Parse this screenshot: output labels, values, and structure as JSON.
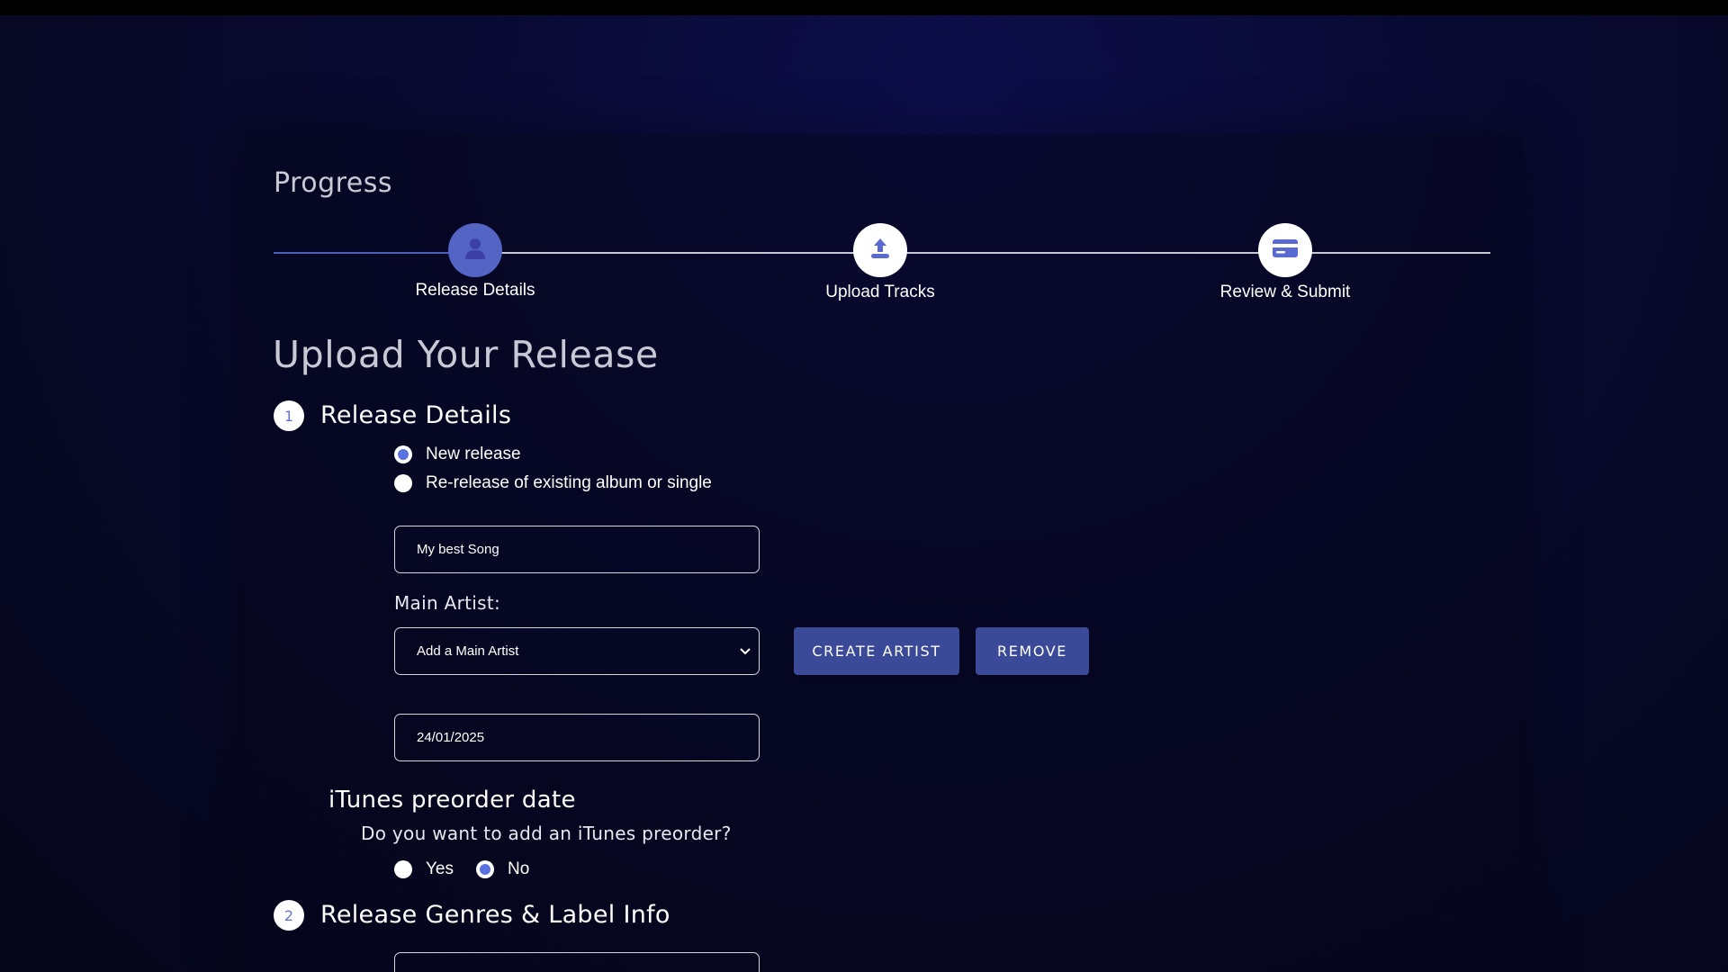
{
  "progress": {
    "title": "Progress",
    "steps": [
      {
        "label": "Release Details",
        "icon": "person-icon",
        "state": "active"
      },
      {
        "label": "Upload Tracks",
        "icon": "upload-icon",
        "state": "idle"
      },
      {
        "label": "Review & Submit",
        "icon": "credit-card-icon",
        "state": "idle"
      }
    ]
  },
  "main": {
    "title": "Upload Your Release",
    "section1": {
      "number": "1",
      "title": "Release Details",
      "release_type": {
        "options": [
          "New release",
          "Re-release of existing album or single"
        ],
        "selected": "New release"
      },
      "release_title_value": "My best Song",
      "main_artist_label": "Main Artist:",
      "main_artist_select_value": "Add a Main Artist",
      "create_artist_label": "CREATE ARTIST",
      "remove_label": "REMOVE",
      "release_date_value": "24/01/2025"
    },
    "itunes": {
      "title": "iTunes preorder date",
      "question": "Do you want to add an iTunes preorder?",
      "options": [
        "Yes",
        "No"
      ],
      "selected": "No"
    },
    "section2": {
      "number": "2",
      "title": "Release Genres & Label Info"
    }
  },
  "colors": {
    "accent": "#5364c4",
    "button": "#3a4a99",
    "radio_dot": "#5a72e0",
    "background": "#090a33"
  }
}
